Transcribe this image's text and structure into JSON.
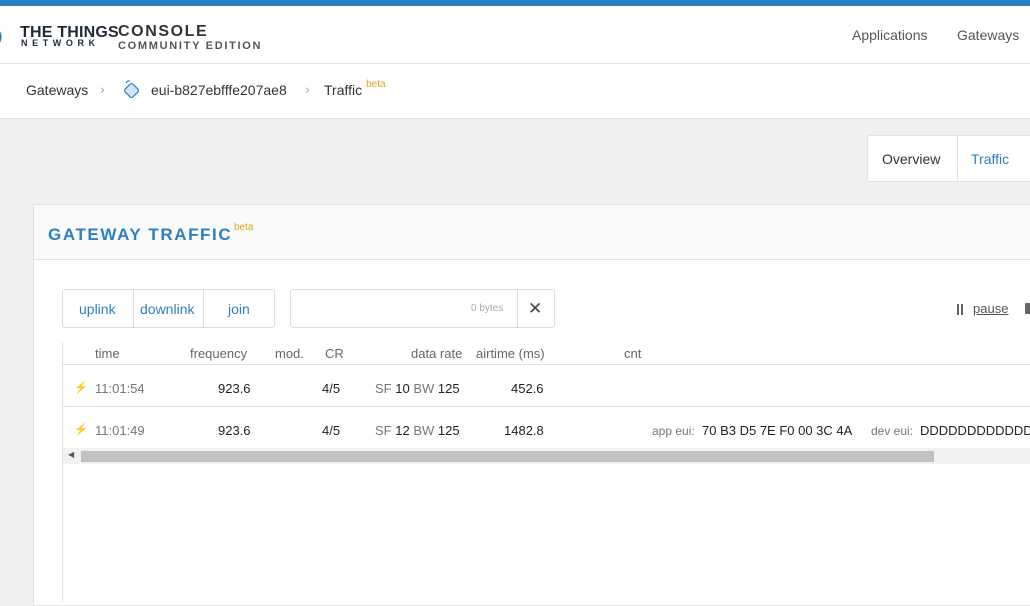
{
  "header": {
    "brand_line1": "THE THINGS",
    "brand_line2": "NETWORK",
    "console_line1": "CONSOLE",
    "console_line2": "COMMUNITY EDITION",
    "nav": [
      "Applications",
      "Gateways"
    ]
  },
  "breadcrumb": {
    "items": [
      "Gateways",
      "eui-b827ebfffe207ae8",
      "Traffic"
    ],
    "beta": "beta"
  },
  "tabs": [
    "Overview",
    "Traffic"
  ],
  "card": {
    "title": "GATEWAY TRAFFIC",
    "beta": "beta",
    "filters": [
      "uplink",
      "downlink",
      "join"
    ],
    "payload_bytes": "0 bytes",
    "clear_symbol": "✕",
    "pause_label": "pause"
  },
  "table": {
    "columns": [
      "time",
      "frequency",
      "mod.",
      "CR",
      "data rate",
      "airtime (ms)",
      "cnt"
    ],
    "rows": [
      {
        "status_color": "#4caf50",
        "time": "11:01:54",
        "frequency": "923.6",
        "cr": "4/5",
        "sf_label": "SF",
        "sf": "10",
        "bw_label": "BW",
        "bw": "125",
        "airtime": "452.6"
      },
      {
        "status_color": "#e0a419",
        "time": "11:01:49",
        "frequency": "923.6",
        "cr": "4/5",
        "sf_label": "SF",
        "sf": "12",
        "bw_label": "BW",
        "bw": "125",
        "airtime": "1482.8",
        "app_eui_label": "app eui:",
        "app_eui": "70 B3 D5 7E F0 00 3C 4A",
        "dev_eui_label": "dev eui:",
        "dev_eui": "DDDDDDDDDDDDDDDD"
      }
    ]
  },
  "colors": {
    "accent": "#2d7fc2",
    "beta": "#e0a419"
  },
  "icons": [
    "ttn-logo-icon",
    "gateway-icon",
    "chevron-right-icon",
    "pause-icon",
    "trash-icon",
    "bolt-icon"
  ]
}
